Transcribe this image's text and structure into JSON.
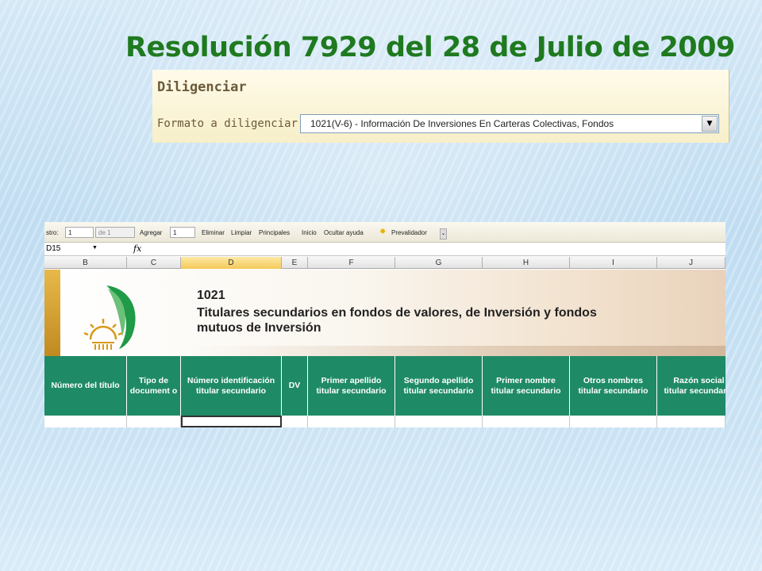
{
  "slide": {
    "title": "Resolución 7929 del 28 de Julio de 2009"
  },
  "diligenciar": {
    "title": "Diligenciar",
    "label": "Formato a diligenciar:",
    "selected": "1021(V-6) - Información De Inversiones En Carteras Colectivas, Fondos"
  },
  "toolbar": {
    "registro_label": "stro:",
    "registro_value": "1",
    "de_label": "de 1",
    "agregar_label": "Agregar",
    "agregar_value": "1",
    "eliminar": "Eliminar",
    "limpiar": "Limpiar",
    "principales": "Principales",
    "inicio": "Inicio",
    "ocultar": "Ocultar ayuda",
    "prevalidador": "Prevalidador"
  },
  "formula_bar": {
    "cell_ref": "D15",
    "fx": "fx"
  },
  "columns": [
    "B",
    "C",
    "D",
    "E",
    "F",
    "G",
    "H",
    "I",
    "J"
  ],
  "selected_column": "D",
  "banner": {
    "code": "1021",
    "title": "Titulares secundarios en fondos de valores, de Inversión y fondos mutuos de Inversión"
  },
  "headers": [
    "Número del título",
    "Tipo de document o",
    "Número identificación titular secundario",
    "DV",
    "Primer apellido titular secundario",
    "Segundo apellido titular secundario",
    "Primer nombre titular secundario",
    "Otros nombres titular secundario",
    "Razón social titular secundario"
  ],
  "colors": {
    "title_green": "#1f7a1f",
    "header_green": "#1f8a66",
    "logo_green": "#1f9a46",
    "logo_gold": "#d89a18"
  }
}
